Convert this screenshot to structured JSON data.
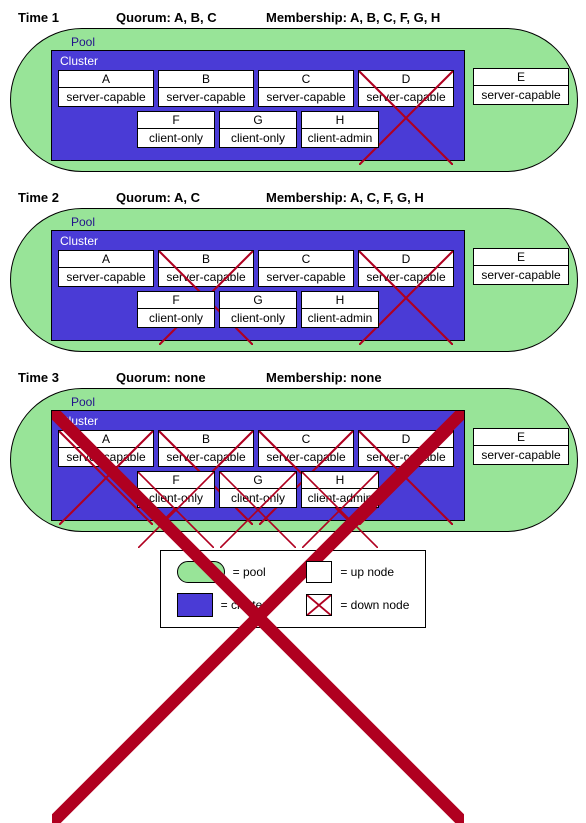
{
  "labels": {
    "pool": "Pool",
    "cluster": "Cluster"
  },
  "legend": {
    "pool": "= pool",
    "cluster": "= cluster",
    "up_node": "= up node",
    "down_node": "= down node"
  },
  "sections": [
    {
      "time": "Time 1",
      "quorum": "Quorum: A, B, C",
      "membership": "Membership: A, B, C, F, G, H",
      "cluster_crossed": false,
      "cluster": {
        "row1": [
          {
            "id": "A",
            "role": "server-capable",
            "down": false
          },
          {
            "id": "B",
            "role": "server-capable",
            "down": false
          },
          {
            "id": "C",
            "role": "server-capable",
            "down": false
          },
          {
            "id": "D",
            "role": "server-capable",
            "down": true
          }
        ],
        "row2": [
          {
            "id": "F",
            "role": "client-only",
            "down": false
          },
          {
            "id": "G",
            "role": "client-only",
            "down": false
          },
          {
            "id": "H",
            "role": "client-admin",
            "down": false
          }
        ]
      },
      "outside": {
        "id": "E",
        "role": "server-capable",
        "down": false
      }
    },
    {
      "time": "Time 2",
      "quorum": "Quorum: A, C",
      "membership": "Membership: A, C, F, G, H",
      "cluster_crossed": false,
      "cluster": {
        "row1": [
          {
            "id": "A",
            "role": "server-capable",
            "down": false
          },
          {
            "id": "B",
            "role": "server-capable",
            "down": true
          },
          {
            "id": "C",
            "role": "server-capable",
            "down": false
          },
          {
            "id": "D",
            "role": "server-capable",
            "down": true
          }
        ],
        "row2": [
          {
            "id": "F",
            "role": "client-only",
            "down": false
          },
          {
            "id": "G",
            "role": "client-only",
            "down": false
          },
          {
            "id": "H",
            "role": "client-admin",
            "down": false
          }
        ]
      },
      "outside": {
        "id": "E",
        "role": "server-capable",
        "down": false
      }
    },
    {
      "time": "Time 3",
      "quorum": "Quorum: none",
      "membership": "Membership: none",
      "cluster_crossed": true,
      "cluster": {
        "row1": [
          {
            "id": "A",
            "role": "server-capable",
            "down": true
          },
          {
            "id": "B",
            "role": "server-capable",
            "down": true
          },
          {
            "id": "C",
            "role": "server-capable",
            "down": true
          },
          {
            "id": "D",
            "role": "server-capable",
            "down": true
          }
        ],
        "row2": [
          {
            "id": "F",
            "role": "client-only",
            "down": true
          },
          {
            "id": "G",
            "role": "client-only",
            "down": true
          },
          {
            "id": "H",
            "role": "client-admin",
            "down": true
          }
        ]
      },
      "outside": {
        "id": "E",
        "role": "server-capable",
        "down": false
      }
    }
  ]
}
